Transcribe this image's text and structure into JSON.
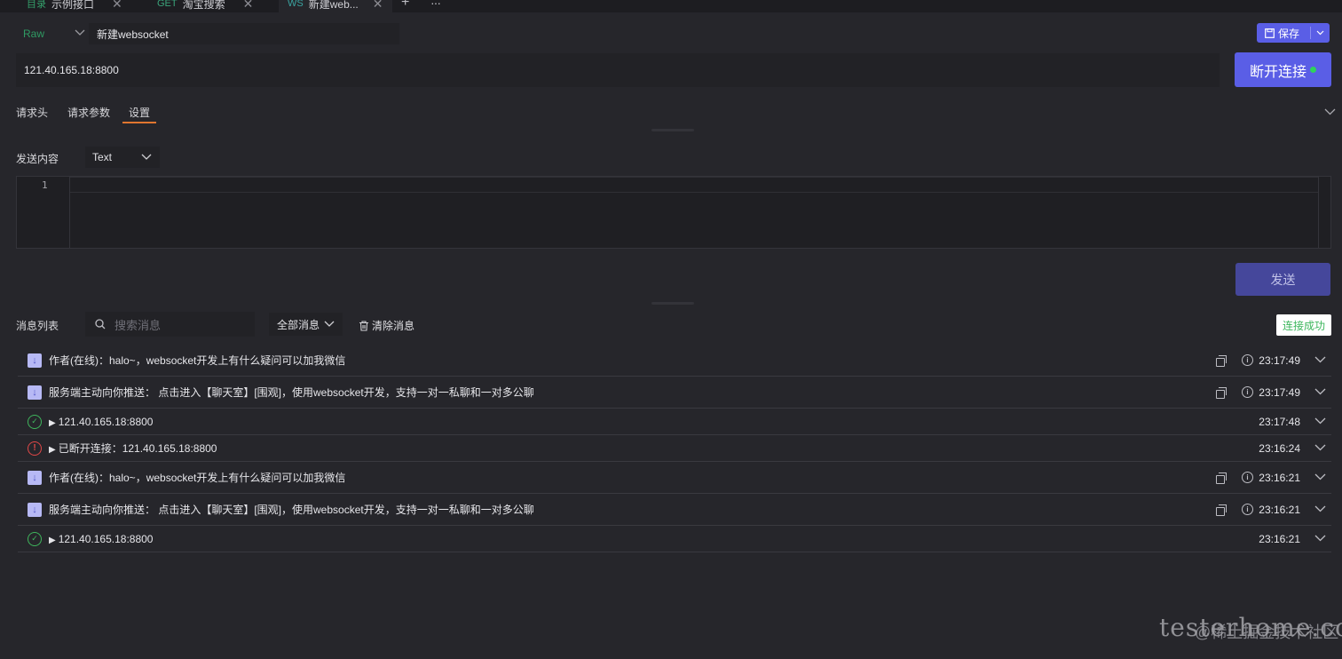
{
  "tabs": [
    {
      "method": "目录",
      "title": "示例接口"
    },
    {
      "method": "GET",
      "title": "淘宝搜索"
    },
    {
      "method": "WS",
      "title": "新建web..."
    }
  ],
  "tab_add": "+",
  "tab_more": "···",
  "request": {
    "mode": "Raw",
    "name": "新建websocket",
    "url": "121.40.165.18:8800",
    "save_label": "保存",
    "disconnect_label": "断开连接"
  },
  "subtabs": [
    "请求头",
    "请求参数",
    "设置"
  ],
  "send": {
    "label": "发送内容",
    "type": "Text",
    "line_number": "1",
    "button": "发送"
  },
  "messages_toolbar": {
    "label": "消息列表",
    "search_placeholder": "搜索消息",
    "filter": "全部消息",
    "clear": "清除消息",
    "status": "连接成功"
  },
  "messages": [
    {
      "kind": "received",
      "text": "作者(在线)：halo~，websocket开发上有什么疑问可以加我微信",
      "time": "23:17:49"
    },
    {
      "kind": "received",
      "text": "服务端主动向你推送： 点击进入【聊天室】[围观]，使用websocket开发，支持一对一私聊和一对多公聊",
      "time": "23:17:49"
    },
    {
      "kind": "connected",
      "text": "121.40.165.18:8800",
      "time": "23:17:48"
    },
    {
      "kind": "disconnected",
      "text": "已断开连接：121.40.165.18:8800",
      "time": "23:16:24"
    },
    {
      "kind": "received",
      "text": "作者(在线)：halo~，websocket开发上有什么疑问可以加我微信",
      "time": "23:16:21"
    },
    {
      "kind": "received",
      "text": "服务端主动向你推送： 点击进入【聊天室】[围观]，使用websocket开发，支持一对一私聊和一对多公聊",
      "time": "23:16:21"
    },
    {
      "kind": "connected",
      "text": "121.40.165.18:8800",
      "time": "23:16:21"
    }
  ],
  "watermark": {
    "script": "testerhome.com",
    "text": "@稀土掘金技术社区"
  },
  "colors": {
    "accent": "#5a5ee6",
    "success": "#3fb55c",
    "error": "#e04848",
    "tab_underline": "#e0762f"
  }
}
